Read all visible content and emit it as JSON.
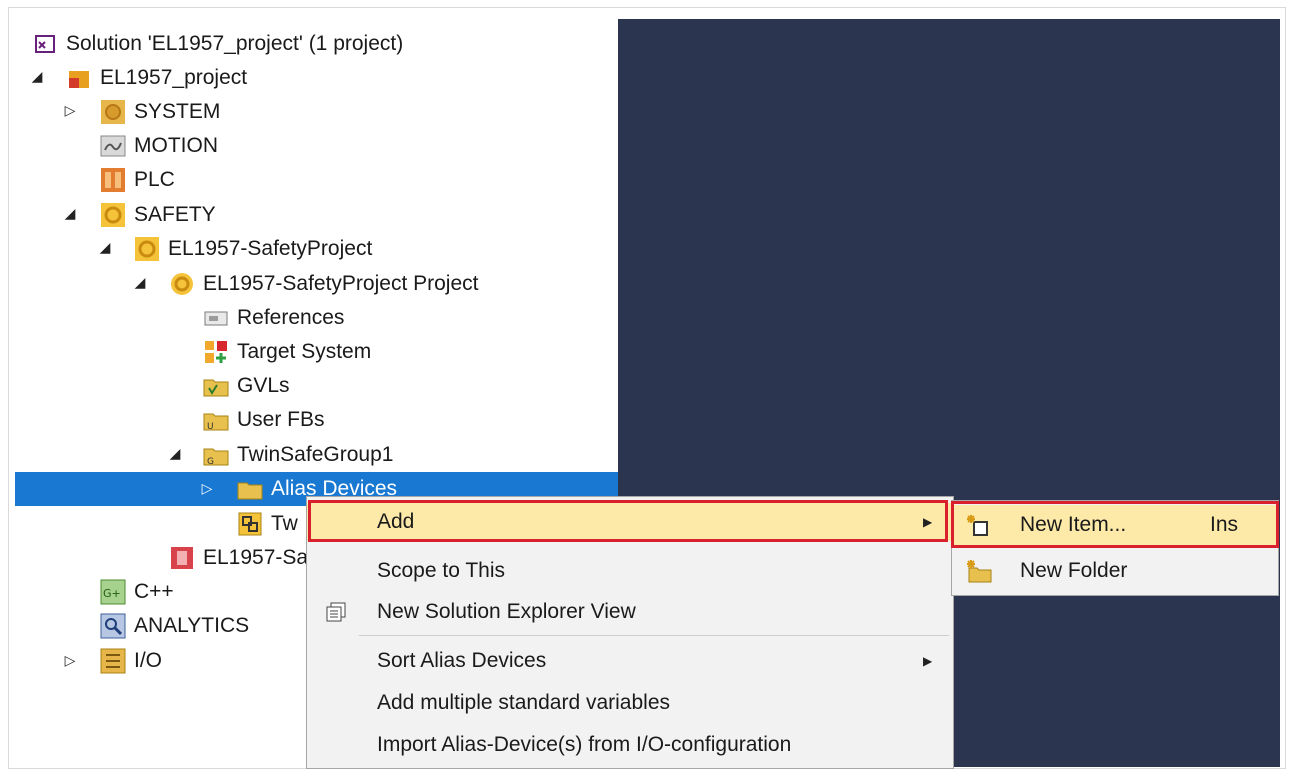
{
  "tree": {
    "solution": "Solution 'EL1957_project' (1 project)",
    "project": "EL1957_project",
    "system": "SYSTEM",
    "motion": "MOTION",
    "plc": "PLC",
    "safety": "SAFETY",
    "safety_project": "EL1957-SafetyProject",
    "safety_project_project": "EL1957-SafetyProject Project",
    "references": "References",
    "target_system": "Target System",
    "gvls": "GVLs",
    "user_fbs": "User FBs",
    "twinsafe_group": "TwinSafeGroup1",
    "alias_devices": "Alias Devices",
    "tw_partial": "Tw",
    "el1957_partial": "EL1957-Sa",
    "cpp": "C++",
    "analytics": "ANALYTICS",
    "io": "I/O"
  },
  "context_menu": {
    "add": "Add",
    "scope_to_this": "Scope to This",
    "new_solution_explorer_view": "New Solution Explorer View",
    "sort_alias_devices": "Sort Alias Devices",
    "add_multiple_standard_variables": "Add multiple standard variables",
    "import_alias_devices": "Import Alias-Device(s) from I/O-configuration"
  },
  "submenu": {
    "new_item": "New Item...",
    "new_item_shortcut": "Ins",
    "new_folder": "New Folder"
  },
  "colors": {
    "selection": "#1979d2",
    "highlight_border": "#d8212d",
    "menu_hover": "#fde9a8",
    "dark_panel": "#2b3550"
  },
  "icons": {
    "expanded": "triangle-down-right",
    "collapsed": "triangle-right"
  }
}
